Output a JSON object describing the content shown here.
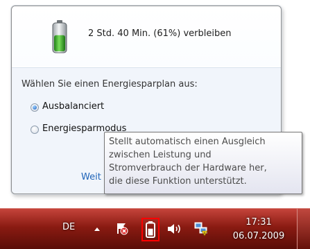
{
  "flyout": {
    "battery_status": "2 Std. 40 Min. (61%) verbleiben",
    "battery_icon": "battery-charge-icon",
    "battery_level": 0.61,
    "plans_heading": "Wählen Sie einen Energiesparplan aus:",
    "plans": [
      {
        "label": "Ausbalanciert",
        "selected": true
      },
      {
        "label": "Energiesparmodus",
        "selected": false
      }
    ],
    "more_link": "Weit"
  },
  "tooltip": {
    "lines": [
      "Stellt automatisch einen Ausgleich",
      "zwischen Leistung und",
      "Stromverbrauch der Hardware her,",
      "die diese Funktion unterstützt."
    ]
  },
  "taskbar": {
    "language": "DE",
    "time": "17:31",
    "date": "06.07.2009",
    "icons": [
      "show-hidden-icons-icon",
      "action-center-flag-icon",
      "battery-icon",
      "volume-icon",
      "network-icon"
    ],
    "highlight_color": "#ff0000",
    "bar_color": "#8a1b12"
  },
  "colors": {
    "battery_fill": "#3aa72b",
    "link": "#1e63b8"
  }
}
